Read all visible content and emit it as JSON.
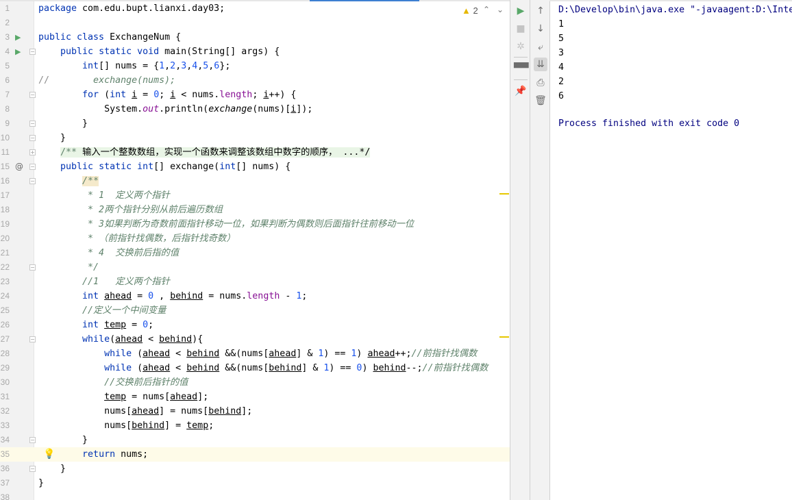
{
  "editor": {
    "warnings": {
      "icon": "warning-icon",
      "count": "2"
    },
    "current_line": 35,
    "lines": [
      {
        "n": "1",
        "t": [
          [
            "package",
            "kw"
          ],
          [
            " com.edu.bupt.lianxi.day03;",
            ""
          ]
        ]
      },
      {
        "n": "2",
        "t": []
      },
      {
        "n": "3",
        "g": "run",
        "t": [
          [
            "public class",
            "kw"
          ],
          [
            " ExchangeNum {",
            ""
          ]
        ]
      },
      {
        "n": "4",
        "g": "run",
        "f": "-",
        "t": [
          [
            "    "
          ],
          [
            "public static void",
            "kw"
          ],
          [
            " main(String[] args) {",
            ""
          ]
        ]
      },
      {
        "n": "5",
        "t": [
          [
            "        "
          ],
          [
            "int",
            "kw"
          ],
          [
            "[] nums = {",
            ""
          ],
          [
            "1",
            "num"
          ],
          [
            ",",
            ""
          ],
          [
            "2",
            "num"
          ],
          [
            ",",
            ""
          ],
          [
            "3",
            "num"
          ],
          [
            ",",
            ""
          ],
          [
            "4",
            "num"
          ],
          [
            ",",
            ""
          ],
          [
            "5",
            "num"
          ],
          [
            ",",
            ""
          ],
          [
            "6",
            "num"
          ],
          [
            "};",
            ""
          ]
        ]
      },
      {
        "n": "6",
        "t": [
          [
            "//",
            "lc"
          ],
          [
            "        exchange(nums);",
            "cm"
          ]
        ]
      },
      {
        "n": "7",
        "f": "-",
        "t": [
          [
            "        "
          ],
          [
            "for",
            "kw"
          ],
          [
            " (",
            ""
          ],
          [
            "int",
            "kw"
          ],
          [
            " ",
            ""
          ],
          [
            "i",
            "u"
          ],
          [
            " = ",
            ""
          ],
          [
            "0",
            "num"
          ],
          [
            "; ",
            ""
          ],
          [
            "i",
            "u"
          ],
          [
            " < nums.",
            ""
          ],
          [
            "length",
            "fld"
          ],
          [
            "; ",
            ""
          ],
          [
            "i",
            "u"
          ],
          [
            "++) {",
            ""
          ]
        ]
      },
      {
        "n": "8",
        "t": [
          [
            "            System.",
            ""
          ],
          [
            "out",
            "fld it"
          ],
          [
            ".println(",
            ""
          ],
          [
            "exchange",
            "it"
          ],
          [
            "(nums)[",
            ""
          ],
          [
            "i",
            "u"
          ],
          [
            "]);",
            ""
          ]
        ]
      },
      {
        "n": "9",
        "f": "-",
        "t": [
          [
            "        }",
            ""
          ]
        ]
      },
      {
        "n": "10",
        "f": "-",
        "t": [
          [
            "    }",
            ""
          ]
        ]
      },
      {
        "n": "11",
        "f": "+",
        "t": [
          [
            "    "
          ],
          [
            "/** ",
            "fcm fc"
          ],
          [
            "输入一个整数数组，实现一个函数来调整该数组中数字的顺序， ...*/",
            "fc"
          ]
        ]
      },
      {
        "n": "15",
        "g": "at",
        "f": "-",
        "t": [
          [
            "    "
          ],
          [
            "public static int",
            "kw"
          ],
          [
            "[] exchange(",
            ""
          ],
          [
            "int",
            "kw"
          ],
          [
            "[] nums) {",
            ""
          ]
        ]
      },
      {
        "n": "16",
        "f": "-",
        "t": [
          [
            "        "
          ],
          [
            "/**",
            "cm hl"
          ]
        ]
      },
      {
        "n": "17",
        "t": [
          [
            "         * 1  定义两个指针",
            "cm"
          ]
        ]
      },
      {
        "n": "18",
        "t": [
          [
            "         * 2两个指针分别从前后遍历数组",
            "cm"
          ]
        ]
      },
      {
        "n": "19",
        "t": [
          [
            "         * 3如果判断为奇数前面指针移动一位，如果判断为偶数则后面指针往前移动一位",
            "cm"
          ]
        ]
      },
      {
        "n": "20",
        "t": [
          [
            "         * （前指针找偶数，后指针找奇数）",
            "cm"
          ]
        ]
      },
      {
        "n": "21",
        "t": [
          [
            "         * 4  交换前后指的值",
            "cm"
          ]
        ]
      },
      {
        "n": "22",
        "f": "-",
        "t": [
          [
            "         */",
            "cm"
          ]
        ]
      },
      {
        "n": "23",
        "t": [
          [
            "        "
          ],
          [
            "//1   定义两个指针",
            "cm"
          ]
        ]
      },
      {
        "n": "24",
        "t": [
          [
            "        "
          ],
          [
            "int",
            "kw"
          ],
          [
            " ",
            ""
          ],
          [
            "ahead",
            "u"
          ],
          [
            " = ",
            ""
          ],
          [
            "0",
            "num"
          ],
          [
            " , ",
            ""
          ],
          [
            "behind",
            "u"
          ],
          [
            " = nums.",
            ""
          ],
          [
            "length",
            "fld"
          ],
          [
            " - ",
            ""
          ],
          [
            "1",
            "num"
          ],
          [
            ";",
            ""
          ]
        ]
      },
      {
        "n": "25",
        "t": [
          [
            "        "
          ],
          [
            "//定义一个中间变量",
            "cm"
          ]
        ]
      },
      {
        "n": "26",
        "t": [
          [
            "        "
          ],
          [
            "int",
            "kw"
          ],
          [
            " ",
            ""
          ],
          [
            "temp",
            "u"
          ],
          [
            " = ",
            ""
          ],
          [
            "0",
            "num"
          ],
          [
            ";",
            ""
          ]
        ]
      },
      {
        "n": "27",
        "f": "-",
        "t": [
          [
            "        "
          ],
          [
            "while",
            "kw"
          ],
          [
            "(",
            ""
          ],
          [
            "ahead",
            "u"
          ],
          [
            " < ",
            ""
          ],
          [
            "behind",
            "u"
          ],
          [
            "){",
            ""
          ]
        ]
      },
      {
        "n": "28",
        "t": [
          [
            "            "
          ],
          [
            "while",
            "kw"
          ],
          [
            " (",
            ""
          ],
          [
            "ahead",
            "u"
          ],
          [
            " < ",
            ""
          ],
          [
            "behind",
            "u"
          ],
          [
            " &&(nums[",
            ""
          ],
          [
            "ahead",
            "u"
          ],
          [
            "] & ",
            ""
          ],
          [
            "1",
            "num"
          ],
          [
            ") == ",
            ""
          ],
          [
            "1",
            "num"
          ],
          [
            ") ",
            ""
          ],
          [
            "ahead",
            "u"
          ],
          [
            "++;",
            ""
          ],
          [
            "//前指针找偶数",
            "cm"
          ]
        ]
      },
      {
        "n": "29",
        "t": [
          [
            "            "
          ],
          [
            "while",
            "kw"
          ],
          [
            " (",
            ""
          ],
          [
            "ahead",
            "u"
          ],
          [
            " < ",
            ""
          ],
          [
            "behind",
            "u"
          ],
          [
            " &&(nums[",
            ""
          ],
          [
            "behind",
            "u"
          ],
          [
            "] & ",
            ""
          ],
          [
            "1",
            "num"
          ],
          [
            ") == ",
            ""
          ],
          [
            "0",
            "num"
          ],
          [
            ") ",
            ""
          ],
          [
            "behind",
            "u"
          ],
          [
            "--;",
            ""
          ],
          [
            "//前指针找偶数",
            "cm"
          ]
        ]
      },
      {
        "n": "30",
        "t": [
          [
            "            "
          ],
          [
            "//交换前后指针的值",
            "cm"
          ]
        ]
      },
      {
        "n": "31",
        "t": [
          [
            "            "
          ],
          [
            "temp",
            "u"
          ],
          [
            " = nums[",
            ""
          ],
          [
            "ahead",
            "u"
          ],
          [
            "];",
            ""
          ]
        ]
      },
      {
        "n": "32",
        "t": [
          [
            "            nums[",
            ""
          ],
          [
            "ahead",
            "u"
          ],
          [
            "] = nums[",
            ""
          ],
          [
            "behind",
            "u"
          ],
          [
            "];",
            ""
          ]
        ]
      },
      {
        "n": "33",
        "t": [
          [
            "            nums[",
            ""
          ],
          [
            "behind",
            "u"
          ],
          [
            "] = ",
            ""
          ],
          [
            "temp",
            "u"
          ],
          [
            ";",
            ""
          ]
        ]
      },
      {
        "n": "34",
        "f": "-",
        "t": [
          [
            "        }",
            ""
          ]
        ]
      },
      {
        "n": "35",
        "g": "bulb",
        "t": [
          [
            "        "
          ],
          [
            "return",
            "kw"
          ],
          [
            " nums;",
            ""
          ]
        ]
      },
      {
        "n": "36",
        "f": "-",
        "t": [
          [
            "    }",
            ""
          ]
        ]
      },
      {
        "n": "37",
        "t": [
          [
            "}",
            ""
          ]
        ]
      },
      {
        "n": "38",
        "t": []
      }
    ]
  },
  "run_toolbar": [
    {
      "name": "rerun-icon",
      "glyph": "▶",
      "color": "#59a869"
    },
    {
      "name": "stop-icon",
      "glyph": "■",
      "color": "#c4c4c4"
    },
    {
      "name": "debug-icon",
      "glyph": "✲",
      "color": "#c4c4c4"
    },
    {
      "name": "layout-icon",
      "glyph": "▀▀",
      "color": "#6e6e6e"
    },
    {
      "name": "pin-icon",
      "glyph": "📌",
      "color": "#6e6e6e"
    }
  ],
  "console_toolbar": [
    {
      "name": "arrow-up-icon",
      "glyph": "↑"
    },
    {
      "name": "arrow-down-icon",
      "glyph": "↓"
    },
    {
      "name": "soft-wrap-icon",
      "glyph": "⤶"
    },
    {
      "name": "scroll-to-end-icon",
      "glyph": "⇊",
      "selected": true
    },
    {
      "name": "print-icon",
      "glyph": "⎙"
    },
    {
      "name": "trash-icon",
      "glyph": "🗑"
    }
  ],
  "console": {
    "command": "D:\\Develop\\bin\\java.exe \"-javaagent:D:\\Inte",
    "output": [
      "1",
      "5",
      "3",
      "4",
      "2",
      "6"
    ],
    "exit_message": "Process finished with exit code 0"
  }
}
